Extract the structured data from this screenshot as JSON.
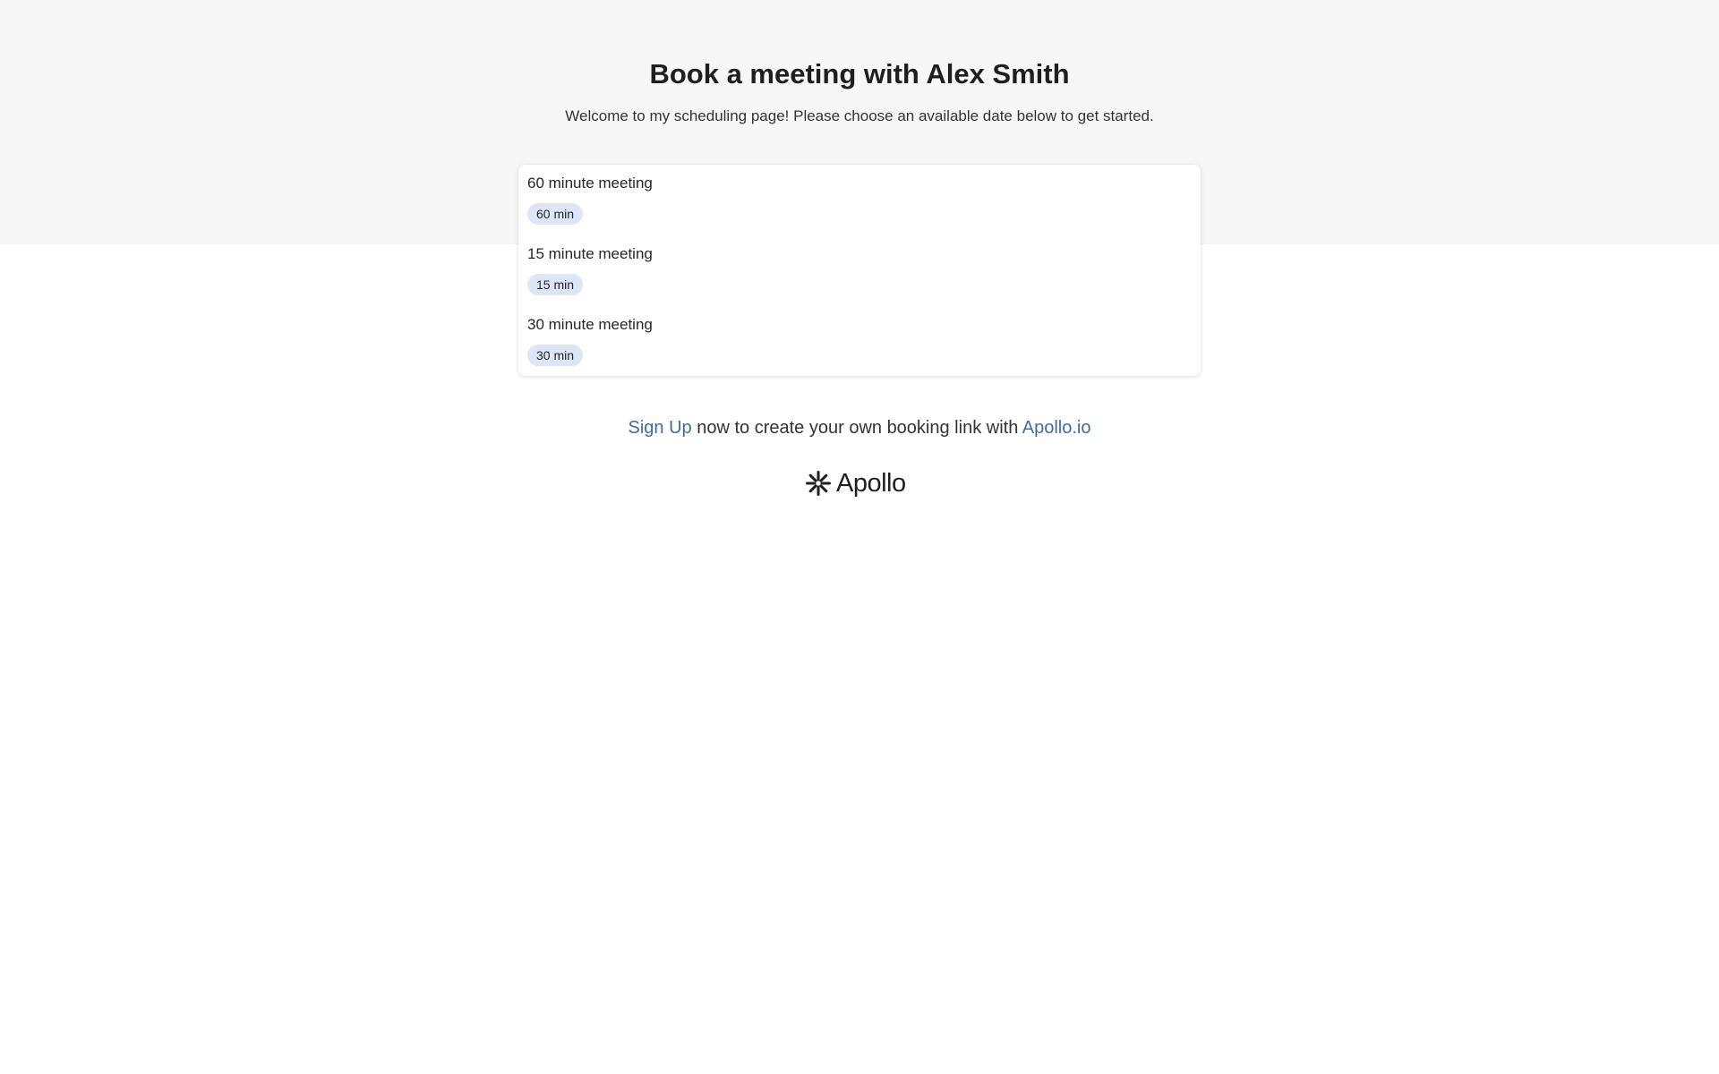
{
  "header": {
    "title": "Book a meeting with Alex Smith",
    "welcome": "Welcome to my scheduling page! Please choose an available date below to get started."
  },
  "meetings": [
    {
      "name": "60 minute meeting",
      "duration": "60 min"
    },
    {
      "name": "15 minute meeting",
      "duration": "15 min"
    },
    {
      "name": "30 minute meeting",
      "duration": "30 min"
    }
  ],
  "footer": {
    "signup_link": "Sign Up",
    "signup_text": " now to create your own booking link with ",
    "apollo_link": "Apollo.io",
    "brand_name": "Apollo",
    "brand_icon": "apollo-starburst-icon"
  },
  "colors": {
    "hero_background": "#f7f7f7",
    "link": "#3b6ea5",
    "badge_background": "#dde5f7"
  }
}
